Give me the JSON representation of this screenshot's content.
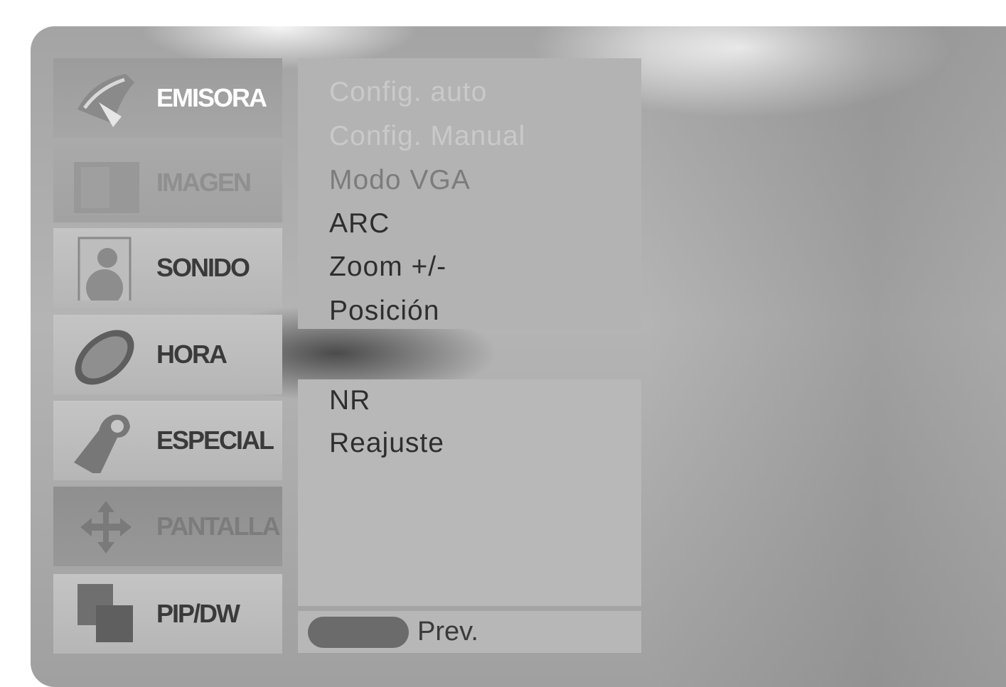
{
  "sidebar": {
    "items": [
      {
        "label": "EMISORA",
        "icon": "satellite-dish-icon",
        "state": "active"
      },
      {
        "label": "IMAGEN",
        "icon": "picture-icon",
        "state": "normal"
      },
      {
        "label": "SONIDO",
        "icon": "speaker-icon",
        "state": "normal"
      },
      {
        "label": "HORA",
        "icon": "clock-icon",
        "state": "normal"
      },
      {
        "label": "ESPECIAL",
        "icon": "tag-icon",
        "state": "normal"
      },
      {
        "label": "PANTALLA",
        "icon": "arrows-icon",
        "state": "disabled"
      },
      {
        "label": "PIP/DW",
        "icon": "pip-icon",
        "state": "normal"
      }
    ]
  },
  "submenu": {
    "items": [
      {
        "label": "Config. auto",
        "state": "disabled"
      },
      {
        "label": "Config. Manual",
        "state": "disabled"
      },
      {
        "label": "Modo VGA",
        "state": "semi-disabled"
      },
      {
        "label": "ARC",
        "state": "enabled"
      },
      {
        "label": "Zoom +/-",
        "state": "enabled"
      },
      {
        "label": "Posición",
        "state": "enabled"
      }
    ],
    "extra_items": [
      {
        "label": "NR",
        "state": "enabled"
      },
      {
        "label": "Reajuste",
        "state": "enabled"
      }
    ]
  },
  "footer": {
    "prev_label": "Prev.",
    "prev_key_color": "#6b6b6b"
  },
  "colors": {
    "panel": "#b3b3b3",
    "text": "#2e2e2e",
    "active_tab_text": "#ffffff"
  }
}
